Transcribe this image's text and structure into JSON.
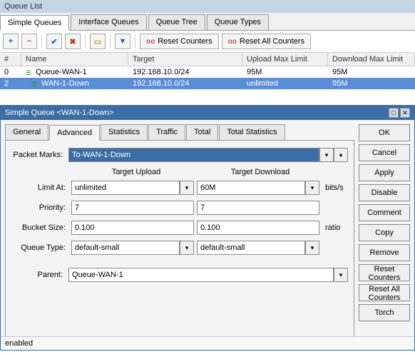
{
  "window": {
    "title": "Queue List"
  },
  "tabs": {
    "simple": "Simple Queues",
    "interface": "Interface Queues",
    "tree": "Queue Tree",
    "types": "Queue Types"
  },
  "toolbar": {
    "reset_counters": "Reset Counters",
    "reset_all_counters": "Reset All Counters"
  },
  "table": {
    "headers": {
      "num": "#",
      "name": "Name",
      "target": "Target",
      "upload": "Upload Max Limit",
      "download": "Download Max Limit"
    },
    "rows": [
      {
        "num": "0",
        "name": "Queue-WAN-1",
        "target": "192.168.10.0/24",
        "upload": "95M",
        "download": "95M",
        "indent": false
      },
      {
        "num": "2",
        "name": "WAN-1-Down",
        "target": "192.168.10.0/24",
        "upload": "unlimited",
        "download": "95M",
        "indent": true
      }
    ]
  },
  "dialog": {
    "title": "Simple Queue <WAN-1-Down>",
    "tabs": {
      "general": "General",
      "advanced": "Advanced",
      "statistics": "Statistics",
      "traffic": "Traffic",
      "total": "Total",
      "total_stats": "Total Statistics"
    },
    "form": {
      "packet_marks_label": "Packet Marks:",
      "packet_marks": "To-WAN-1-Down",
      "target_upload_hdr": "Target Upload",
      "target_download_hdr": "Target Download",
      "limit_at_label": "Limit At:",
      "limit_at_up": "unlimited",
      "limit_at_down": "60M",
      "limit_at_unit": "bits/s",
      "priority_label": "Priority:",
      "priority_up": "7",
      "priority_down": "7",
      "bucket_label": "Bucket Size:",
      "bucket_up": "0.100",
      "bucket_down": "0.100",
      "bucket_unit": "ratio",
      "qtype_label": "Queue Type:",
      "qtype_up": "default-small",
      "qtype_down": "default-small",
      "parent_label": "Parent:",
      "parent": "Queue-WAN-1"
    },
    "buttons": {
      "ok": "OK",
      "cancel": "Cancel",
      "apply": "Apply",
      "disable": "Disable",
      "comment": "Comment",
      "copy": "Copy",
      "remove": "Remove",
      "reset_counters": "Reset Counters",
      "reset_all_counters": "Reset All Counters",
      "torch": "Torch"
    },
    "status": "enabled"
  }
}
